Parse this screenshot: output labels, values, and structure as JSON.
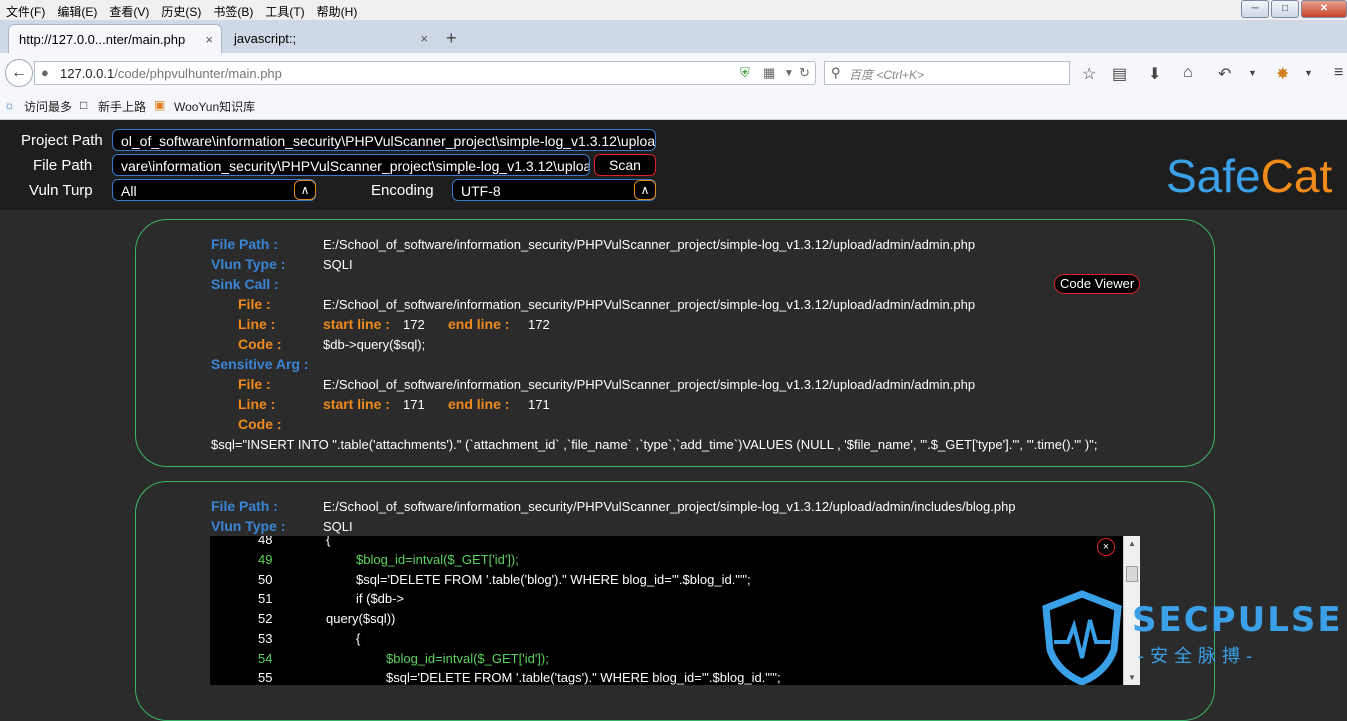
{
  "browser": {
    "menu": [
      "文件(F)",
      "编辑(E)",
      "查看(V)",
      "历史(S)",
      "书签(B)",
      "工具(T)",
      "帮助(H)"
    ],
    "tabs": [
      {
        "label": "http://127.0.0...nter/main.php",
        "close": "×"
      },
      {
        "label": "javascript:;",
        "close": "×"
      }
    ],
    "new_tab": "+",
    "url_host": "127.0.0.1",
    "url_path": "/code/phpvulhunter/main.php",
    "search_placeholder": "百度 <Ctrl+K>",
    "bookmarks": [
      "访问最多",
      "新手上路",
      "WooYun知识库"
    ]
  },
  "header": {
    "project_path_label": "Project Path",
    "project_path_value": "ol_of_software\\information_security\\PHPVulScanner_project\\simple-log_v1.3.12\\upload",
    "file_path_label": "File Path",
    "file_path_value": "vare\\information_security\\PHPVulScanner_project\\simple-log_v1.3.12\\upload",
    "scan_label": "Scan",
    "vuln_type_label": "Vuln Turp",
    "vuln_type_value": "All",
    "encoding_label": "Encoding",
    "encoding_value": "UTF-8",
    "logo_part1": "Safe",
    "logo_part2": "Cat"
  },
  "labels": {
    "file_path": "File Path :",
    "vlun_type": "Vlun Type :",
    "sink_call": "Sink Call :",
    "file": "File :",
    "line": "Line :",
    "code": "Code :",
    "sensitive_arg": "Sensitive Arg :",
    "start_line": "start line :",
    "end_line": "end line :",
    "code_viewer": "Code Viewer"
  },
  "results": [
    {
      "file_path": "E:/School_of_software/information_security/PHPVulScanner_project/simple-log_v1.3.12/upload/admin/admin.php",
      "vuln_type": "SQLI",
      "sink_file": "E:/School_of_software/information_security/PHPVulScanner_project/simple-log_v1.3.12/upload/admin/admin.php",
      "sink_start": "172",
      "sink_end": "172",
      "sink_code": "$db->query($sql);",
      "arg_file": "E:/School_of_software/information_security/PHPVulScanner_project/simple-log_v1.3.12/upload/admin/admin.php",
      "arg_start": "171",
      "arg_end": "171",
      "arg_code": "$sql=\"INSERT INTO \".table('attachments').\" (`attachment_id` ,`file_name` ,`type`,`add_time`)VALUES (NULL , '$file_name', '\".$_GET['type'].\"', '\".time().\"' )\";"
    },
    {
      "file_path": "E:/School_of_software/information_security/PHPVulScanner_project/simple-log_v1.3.12/upload/admin/includes/blog.php",
      "vuln_type": "SQLI"
    }
  ],
  "code_viewer": {
    "close": "×",
    "lines": [
      {
        "n": "48",
        "code": "{"
      },
      {
        "n": "49",
        "code": "$blog_id=intval($_GET['id']);"
      },
      {
        "n": "50",
        "code": "$sql='DELETE FROM '.table('blog').\" WHERE blog_id='\".$blog_id.\"'\";"
      },
      {
        "n": "51",
        "code": "if ($db->"
      },
      {
        "n": "52",
        "code": "query($sql))"
      },
      {
        "n": "53",
        "code": "{"
      },
      {
        "n": "54",
        "code": "$blog_id=intval($_GET['id']);"
      },
      {
        "n": "55",
        "code": "$sql='DELETE FROM '.table('tags').\" WHERE blog_id='\".$blog_id.\"'\";"
      }
    ]
  },
  "watermark": {
    "title": "SECPULSE",
    "subtitle": "-安全脉搏-"
  },
  "colors": {
    "accent_blue": "#3a86d6",
    "accent_orange": "#f08a1a",
    "card_border": "#3bb36b",
    "button_border": "#dd2222",
    "highlight_green": "#5bd35b"
  }
}
